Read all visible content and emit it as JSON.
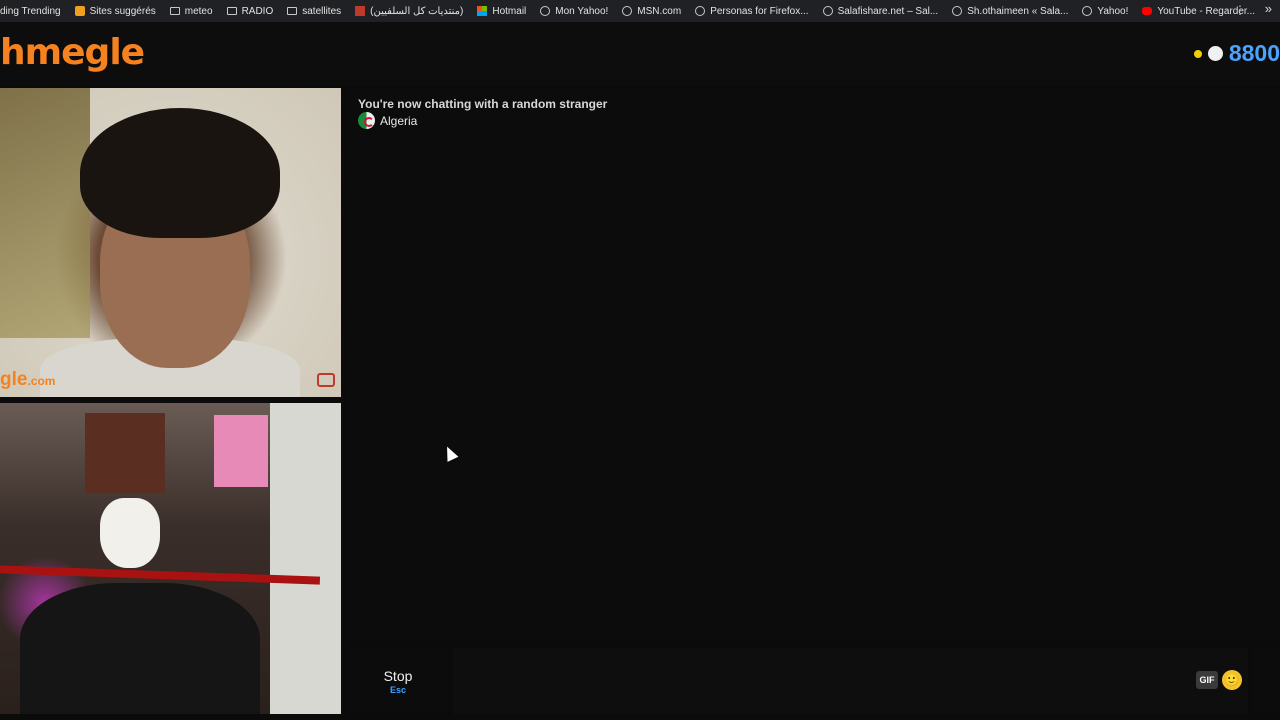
{
  "bookmarks": [
    {
      "label": "ding Trending",
      "icon": "none"
    },
    {
      "label": "Sites suggérés",
      "icon": "orange-square-icon"
    },
    {
      "label": "meteo",
      "icon": "folder-icon"
    },
    {
      "label": "RADIO",
      "icon": "folder-icon"
    },
    {
      "label": "satellites",
      "icon": "folder-icon"
    },
    {
      "label": "(منتديات كل السلفيين)",
      "icon": "red-bar-icon"
    },
    {
      "label": "Hotmail",
      "icon": "microsoft-icon"
    },
    {
      "label": "Mon Yahoo!",
      "icon": "globe-icon"
    },
    {
      "label": "MSN.com",
      "icon": "globe-icon"
    },
    {
      "label": "Personas for Firefox...",
      "icon": "globe-icon"
    },
    {
      "label": "Salafishare.net – Sal...",
      "icon": "globe-icon"
    },
    {
      "label": "Sh.othaimeen « Sala...",
      "icon": "globe-icon"
    },
    {
      "label": "Yahoo!",
      "icon": "globe-icon"
    },
    {
      "label": "YouTube - Regarder...",
      "icon": "youtube-icon"
    }
  ],
  "header": {
    "logo": "hmegle",
    "online_count": "8800"
  },
  "video": {
    "watermark_main": "gle",
    "watermark_suffix": ".com"
  },
  "chat": {
    "status": "You're now chatting with a random stranger",
    "country": "Algeria"
  },
  "controls": {
    "stop_label": "Stop",
    "stop_hint": "Esc",
    "gif_label": "GIF",
    "emoji": "🙂"
  },
  "colors": {
    "brand": "#f6821f",
    "count": "#4aa3ff",
    "hint": "#3aa0ff"
  }
}
